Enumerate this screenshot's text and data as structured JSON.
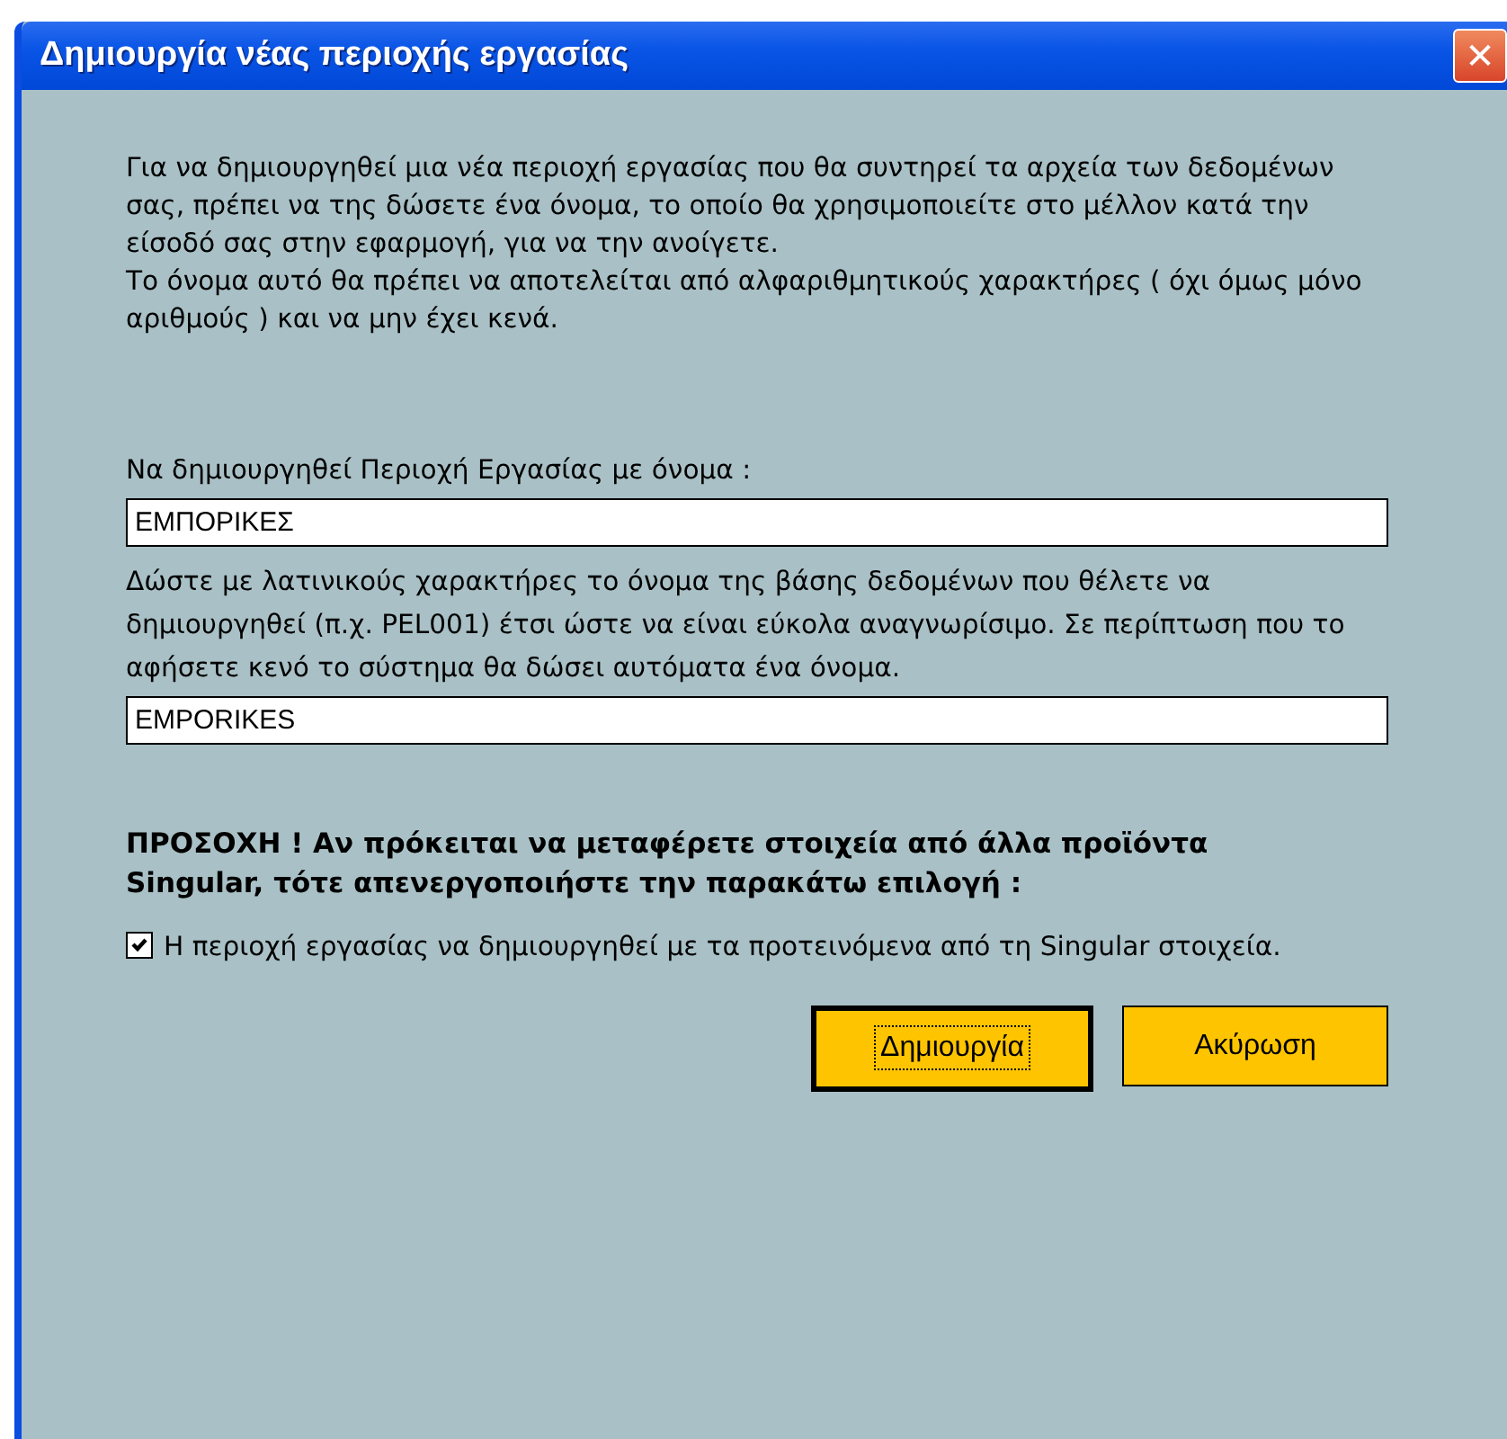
{
  "window": {
    "title": "Δημιουργία νέας περιοχής εργασίας",
    "close": "✕"
  },
  "intro": [
    "Για να δημιουργηθεί μια νέα περιοχή εργασίας που θα συντηρεί τα αρχεία των δεδομένων σας, πρέπει να της δώσετε ένα όνομα, το οποίο θα χρησιμοποιείτε στο μέλλον κατά την είσοδό σας στην εφαρμογή, για να την ανοίγετε.",
    "Το όνομα αυτό θα πρέπει να αποτελείται από αλφαριθμητικούς χαρακτήρες ( όχι όμως μόνο αριθμούς ) και να μην έχει κενά."
  ],
  "name_field": {
    "label": "Να δημιουργηθεί Περιοχή Εργασίας με όνομα :",
    "value": "ΕΜΠΟΡΙΚΕΣ"
  },
  "db_field": {
    "label": "Δώστε με λατινικούς χαρακτήρες το όνομα της βάσης δεδομένων που θέλετε να δημιουργηθεί (π.χ. PEL001) έτσι ώστε να είναι εύκολα αναγνωρίσιμο. Σε περίπτωση που το αφήσετε κενό  το σύστημα θα δώσει αυτόματα ένα όνομα.",
    "value": "EMPORIKES"
  },
  "warning": "ΠΡΟΣΟΧΗ ! Αν πρόκειται να μεταφέρετε στοιχεία από άλλα προϊόντα Singular, τότε απενεργοποιήστε την παρακάτω επιλογή :",
  "checkbox": {
    "label": "Η περιοχή εργασίας να δημιουργηθεί με τα προτεινόμενα από τη Singular στοιχεία.",
    "checked": true
  },
  "buttons": [
    {
      "label": "Δημιουργία",
      "default": true
    },
    {
      "label": "Ακύρωση",
      "default": false
    }
  ]
}
